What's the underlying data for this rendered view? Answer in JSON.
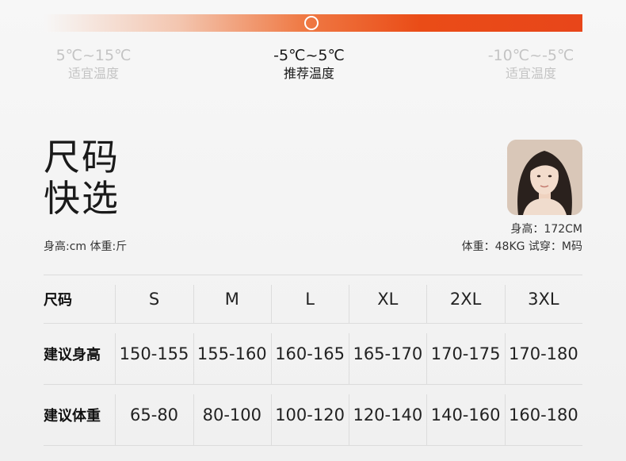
{
  "temperature": {
    "left": {
      "range": "5℃~15℃",
      "label": "适宜温度"
    },
    "middle": {
      "range": "-5℃~5℃",
      "label": "推荐温度"
    },
    "right": {
      "range": "-10℃~-5℃",
      "label": "适宜温度"
    }
  },
  "title": {
    "line1": "尺码",
    "line2": "快选"
  },
  "units_note": "身高:cm   体重:斤",
  "model": {
    "height": "身高：172CM",
    "details": "体重：48KG   试穿：M码"
  },
  "size_table": {
    "header_label": "尺码",
    "sizes": [
      "S",
      "M",
      "L",
      "XL",
      "2XL",
      "3XL"
    ],
    "rows": [
      {
        "label": "建议身高",
        "values": [
          "150-155",
          "155-160",
          "160-165",
          "165-170",
          "170-175",
          "170-180"
        ]
      },
      {
        "label": "建议体重",
        "values": [
          "65-80",
          "80-100",
          "100-120",
          "120-140",
          "140-160",
          "160-180"
        ]
      }
    ]
  },
  "colors": {
    "accent": "#e8461a",
    "dim_text": "#c4c4c4"
  }
}
